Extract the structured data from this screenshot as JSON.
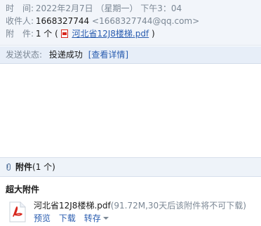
{
  "header": {
    "time_label": "时　间:",
    "time_value": "2022年2月7日 （星期一） 下午3：04",
    "recipient_label": "收件人:",
    "recipient_name": "1668327744",
    "recipient_email": "<1668327744@qq.com>",
    "attachment_label": "附　件:",
    "attachment_count": "1 个 (",
    "attachment_name": "河北省12J8楼梯.pdf",
    "attachment_close": ")"
  },
  "status": {
    "label": "发送状态:",
    "value": "投递成功",
    "details_link": "[查看详情]"
  },
  "attachments": {
    "title": "附件",
    "count": "(1 个)",
    "section_title": "超大附件",
    "files": [
      {
        "name": "河北省12J8楼梯.pdf",
        "meta": "(91.72M,30天后该附件将不可下载)",
        "actions": {
          "preview": "预览",
          "download": "下载",
          "save": "转存"
        }
      }
    ]
  },
  "colors": {
    "link": "#2a5db0",
    "muted": "#7b8794",
    "pdf_red": "#d7261c"
  },
  "icons": {
    "attach": "paperclip-icon",
    "pdf": "pdf-icon"
  }
}
